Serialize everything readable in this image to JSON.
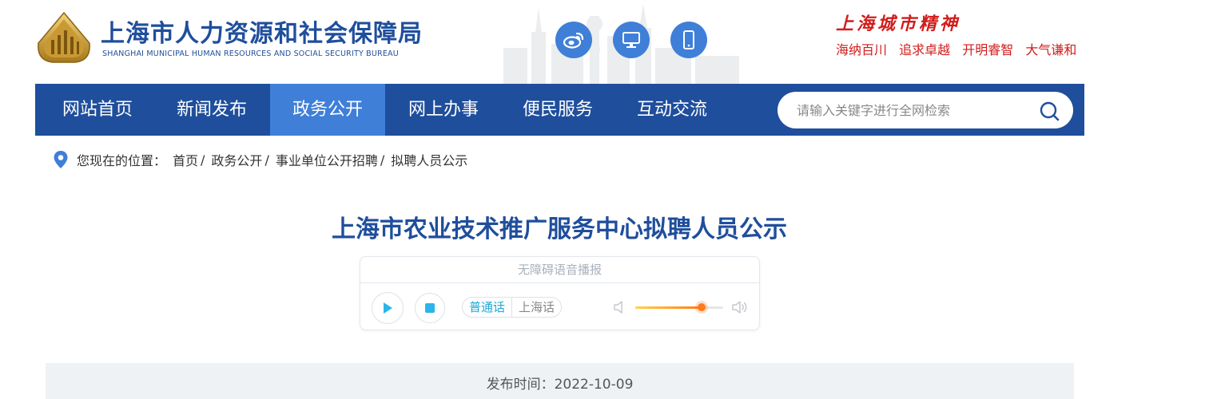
{
  "header": {
    "org_name_cn": "上海市人力资源和社会保障局",
    "org_name_en": "SHANGHAI MUNICIPAL HUMAN RESOURCES AND SOCIAL SECURITY BUREAU",
    "icons": [
      "weibo-icon",
      "desktop-icon",
      "mobile-icon"
    ],
    "spirit_title": "上海城市精神",
    "spirit_words": [
      "海纳百川",
      "追求卓越",
      "开明睿智",
      "大气谦和"
    ]
  },
  "nav": {
    "items": [
      {
        "label": "网站首页"
      },
      {
        "label": "新闻发布"
      },
      {
        "label": "政务公开",
        "active": true
      },
      {
        "label": "网上办事"
      },
      {
        "label": "便民服务"
      },
      {
        "label": "互动交流"
      }
    ],
    "search_placeholder": "请输入关键字进行全网检索"
  },
  "breadcrumb": {
    "prefix": "您现在的位置：",
    "items": [
      "首页",
      "政务公开",
      "事业单位公开招聘",
      "拟聘人员公示"
    ],
    "separator": "/"
  },
  "article": {
    "title": "上海市农业技术推广服务中心拟聘人员公示",
    "publish_label": "发布时间：2022-10-09"
  },
  "player": {
    "title": "无障碍语音播报",
    "languages": [
      "普通话",
      "上海话"
    ],
    "active_language": "普通话",
    "volume_fraction": 0.75
  },
  "colors": {
    "brand_blue": "#1f4e9c",
    "active_blue": "#3f7fd8",
    "spirit_red": "#d21c1c"
  }
}
